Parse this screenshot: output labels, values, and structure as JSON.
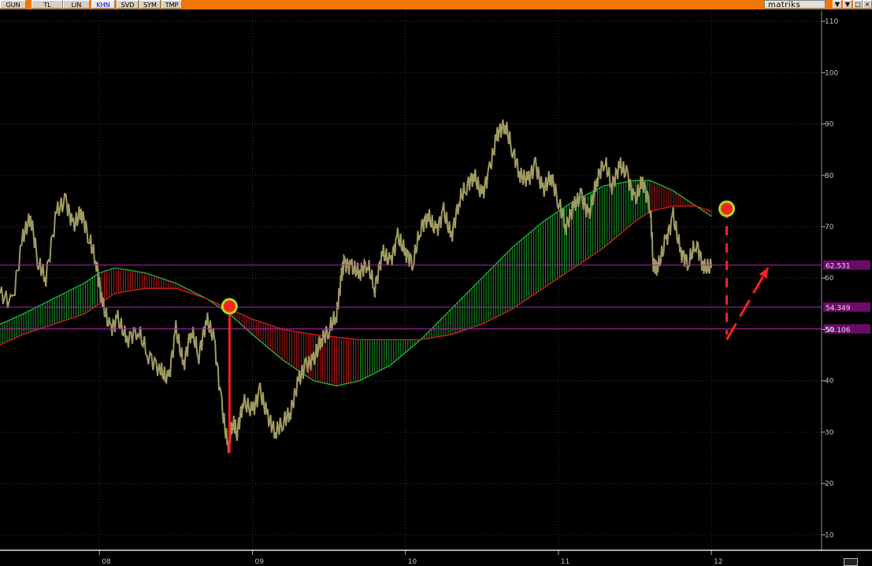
{
  "toolbar": {
    "buttons": [
      {
        "label": "GUN",
        "active": false
      },
      {
        "label": "TL",
        "active": false
      },
      {
        "label": "LIN",
        "active": false
      },
      {
        "label": "KHN",
        "active": true
      },
      {
        "label": "SVD",
        "active": false
      },
      {
        "label": "SYM",
        "active": false
      },
      {
        "label": "TMP",
        "active": false
      }
    ],
    "brand": "matriks",
    "window_buttons": [
      "▼",
      "▼",
      "□",
      "×"
    ]
  },
  "colors": {
    "price": "#a09a60",
    "bull_band": "#20b030",
    "bear_band": "#d02020",
    "fast_ma": "#20c040",
    "slow_ma": "#e02020",
    "level_line": "#b020b0",
    "level_box": "#6a0a6a",
    "annotation": "#ff2020",
    "marker_ring": "#a0e020"
  },
  "chart_data": {
    "type": "line",
    "title": "",
    "xlabel": "",
    "ylabel": "",
    "ylim": [
      7,
      112
    ],
    "xlim": [
      2007.35,
      2012.72
    ],
    "grid": true,
    "y_ticks": [
      10,
      20,
      30,
      40,
      50,
      60,
      70,
      80,
      90,
      100,
      110
    ],
    "x_ticks": [
      {
        "label": "08",
        "value": 2008.0
      },
      {
        "label": "09",
        "value": 2009.0
      },
      {
        "label": "10",
        "value": 2010.0
      },
      {
        "label": "11",
        "value": 2011.0
      },
      {
        "label": "12",
        "value": 2012.0
      }
    ],
    "price_series": {
      "x": [
        2007.35,
        2007.43,
        2007.5,
        2007.55,
        2007.6,
        2007.65,
        2007.72,
        2007.78,
        2007.83,
        2007.88,
        2007.93,
        2007.98,
        2008.02,
        2008.07,
        2008.12,
        2008.18,
        2008.25,
        2008.32,
        2008.4,
        2008.45,
        2008.5,
        2008.55,
        2008.6,
        2008.65,
        2008.7,
        2008.75,
        2008.8,
        2008.84,
        2008.87,
        2008.9,
        2008.94,
        2009.0,
        2009.05,
        2009.1,
        2009.15,
        2009.2,
        2009.25,
        2009.3,
        2009.35,
        2009.4,
        2009.45,
        2009.5,
        2009.55,
        2009.58,
        2009.6,
        2009.65,
        2009.7,
        2009.75,
        2009.8,
        2009.85,
        2009.9,
        2009.95,
        2010.0,
        2010.05,
        2010.1,
        2010.15,
        2010.2,
        2010.25,
        2010.3,
        2010.35,
        2010.4,
        2010.45,
        2010.5,
        2010.55,
        2010.6,
        2010.65,
        2010.7,
        2010.75,
        2010.8,
        2010.85,
        2010.9,
        2010.95,
        2011.0,
        2011.05,
        2011.1,
        2011.15,
        2011.2,
        2011.25,
        2011.3,
        2011.35,
        2011.4,
        2011.45,
        2011.5,
        2011.55,
        2011.6,
        2011.62,
        2011.65,
        2011.7,
        2011.75,
        2011.8,
        2011.85,
        2011.9,
        2011.95,
        2012.0
      ],
      "y": [
        57,
        55,
        68,
        72,
        63,
        60,
        73,
        75,
        70,
        73,
        68,
        63,
        55,
        50,
        52,
        48,
        50,
        45,
        42,
        40,
        50,
        43,
        50,
        45,
        52,
        48,
        35,
        27,
        32,
        30,
        36,
        34,
        38,
        33,
        30,
        32,
        34,
        40,
        43,
        44,
        48,
        50,
        53,
        60,
        63,
        62,
        61,
        63,
        58,
        65,
        63,
        68,
        65,
        63,
        70,
        72,
        69,
        73,
        68,
        75,
        78,
        80,
        76,
        81,
        88,
        90,
        85,
        80,
        79,
        82,
        77,
        80,
        75,
        70,
        74,
        76,
        72,
        79,
        83,
        78,
        82,
        80,
        75,
        79,
        74,
        63,
        62,
        67,
        72,
        65,
        63,
        67,
        62,
        62
      ]
    },
    "band": {
      "x": [
        2007.35,
        2007.5,
        2007.7,
        2007.9,
        2008.0,
        2008.1,
        2008.3,
        2008.5,
        2008.7,
        2008.85,
        2009.0,
        2009.2,
        2009.4,
        2009.55,
        2009.7,
        2009.9,
        2010.1,
        2010.3,
        2010.5,
        2010.7,
        2010.9,
        2011.1,
        2011.3,
        2011.5,
        2011.6,
        2011.75,
        2011.9,
        2012.0
      ],
      "fast": [
        51,
        53,
        56,
        59,
        61,
        62,
        61,
        59,
        56,
        53,
        49,
        44,
        40,
        39,
        40,
        43,
        48,
        54,
        60,
        66,
        71,
        75,
        78,
        79,
        79,
        77,
        74,
        72
      ],
      "slow": [
        47,
        49,
        51,
        53,
        55,
        57,
        58,
        58,
        56,
        54,
        52,
        50,
        49,
        48.5,
        48,
        48,
        48,
        49,
        51,
        54,
        58,
        62,
        66,
        71,
        73,
        74,
        74,
        73
      ],
      "bearish": [
        false,
        false,
        false,
        false,
        true,
        true,
        true,
        true,
        true,
        true,
        true,
        true,
        true,
        true,
        false,
        false,
        false,
        false,
        false,
        false,
        false,
        false,
        false,
        false,
        true,
        true,
        true,
        true
      ]
    },
    "levels": [
      {
        "label": "62.531",
        "value": 62.531
      },
      {
        "label": "54.349",
        "value": 54.349
      },
      {
        "label": "50.106",
        "value": 50.106
      }
    ],
    "markers": [
      {
        "x": 2008.85,
        "y": 54.5,
        "stem_to": 26,
        "dashed": false
      },
      {
        "x": 2012.1,
        "y": 73.5,
        "stem_to": 49,
        "dashed": true
      }
    ],
    "arrow": {
      "from": [
        2012.1,
        48
      ],
      "to": [
        2012.37,
        62
      ]
    }
  }
}
